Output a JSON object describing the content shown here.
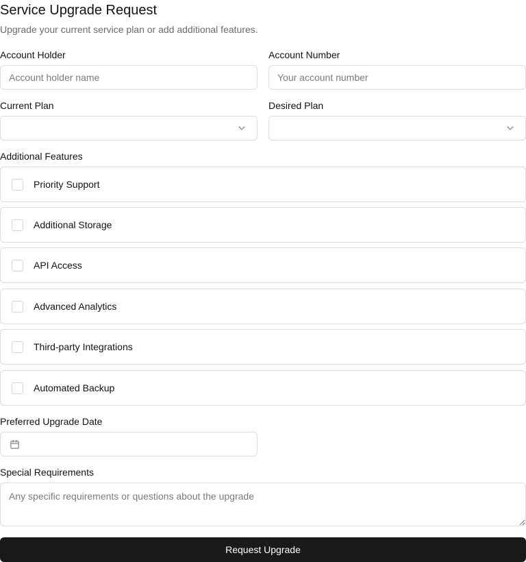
{
  "form": {
    "title": "Service Upgrade Request",
    "subtitle": "Upgrade your current service plan or add additional features."
  },
  "account_holder": {
    "label": "Account Holder",
    "placeholder": "Account holder name",
    "value": ""
  },
  "account_number": {
    "label": "Account Number",
    "placeholder": "Your account number",
    "value": ""
  },
  "current_plan": {
    "label": "Current Plan",
    "selected": ""
  },
  "desired_plan": {
    "label": "Desired Plan",
    "selected": ""
  },
  "features": {
    "label": "Additional Features",
    "items": [
      {
        "label": "Priority Support",
        "checked": false
      },
      {
        "label": "Additional Storage",
        "checked": false
      },
      {
        "label": "API Access",
        "checked": false
      },
      {
        "label": "Advanced Analytics",
        "checked": false
      },
      {
        "label": "Third-party Integrations",
        "checked": false
      },
      {
        "label": "Automated Backup",
        "checked": false
      }
    ]
  },
  "upgrade_date": {
    "label": "Preferred Upgrade Date",
    "value": "",
    "icon": "calendar-icon"
  },
  "special_requirements": {
    "label": "Special Requirements",
    "placeholder": "Any specific requirements or questions about the upgrade"
  },
  "submit": {
    "label": "Request Upgrade"
  },
  "colors": {
    "button_bg": "#1a1a1a",
    "border": "#dcdcdc",
    "muted_text": "#6b6b6b"
  }
}
